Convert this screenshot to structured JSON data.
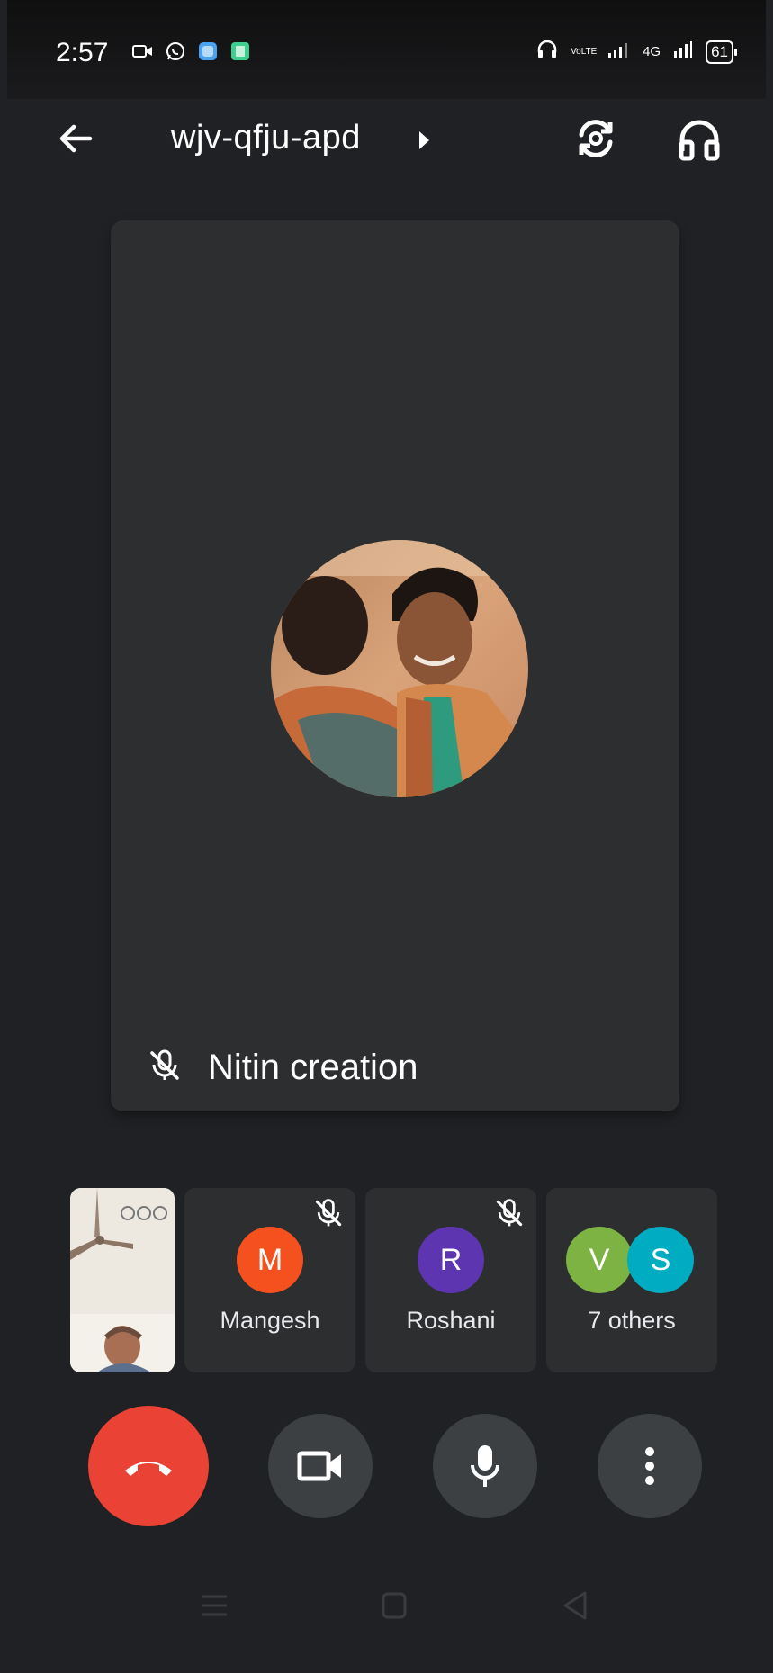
{
  "status_bar": {
    "time": "2:57",
    "battery": "61",
    "network": "4G",
    "volte": "VoLTE"
  },
  "header": {
    "meeting_code": "wjv-qfju-apd"
  },
  "main_tile": {
    "name": "Nitin creation",
    "muted": true
  },
  "participants": [
    {
      "initial": "M",
      "name": "Mangesh",
      "color": "#f4511e",
      "muted": true
    },
    {
      "initial": "R",
      "name": "Roshani",
      "color": "#5e35b1",
      "muted": true
    },
    {
      "initials": [
        "V",
        "S"
      ],
      "name": "7 others",
      "colors": [
        "#7cb342",
        "#00acc1"
      ]
    }
  ],
  "colors": {
    "background": "#202124",
    "tile": "#2d2e30",
    "control": "#3c4043",
    "end_call": "#ea4335"
  }
}
